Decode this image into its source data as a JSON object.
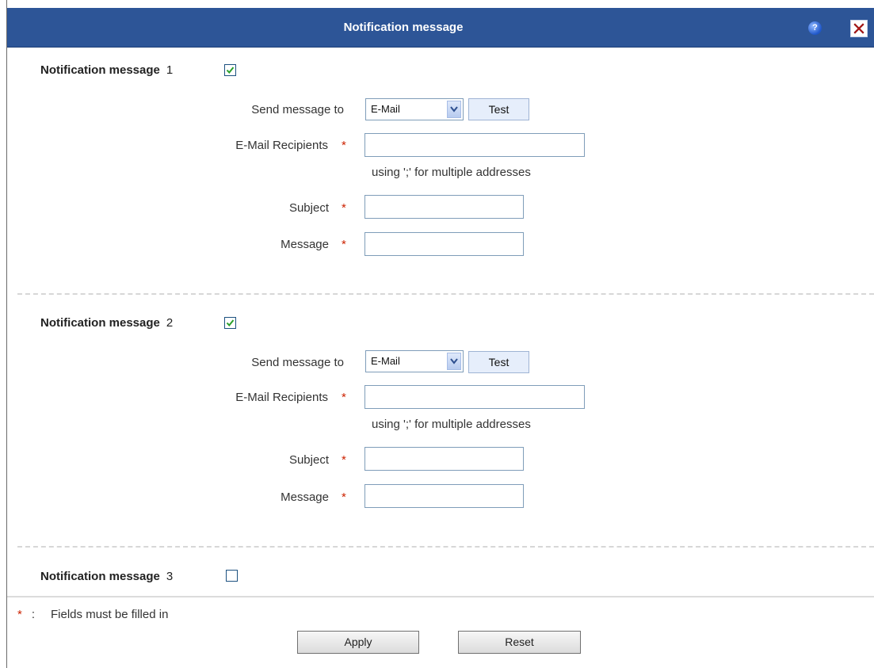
{
  "window": {
    "title": "Notification message",
    "help_icon": "help-icon",
    "close_icon": "close-icon"
  },
  "sections": [
    {
      "heading": "Notification message",
      "number": "1",
      "enabled": true,
      "send_to_label": "Send message to",
      "send_to_value": "E-Mail",
      "test_label": "Test",
      "recipients_label": "E-Mail Recipients",
      "recipients_value": "",
      "hint": "using ';' for multiple addresses",
      "subject_label": "Subject",
      "subject_value": "",
      "message_label": "Message",
      "message_value": ""
    },
    {
      "heading": "Notification message",
      "number": "2",
      "enabled": true,
      "send_to_label": "Send message to",
      "send_to_value": "E-Mail",
      "test_label": "Test",
      "recipients_label": "E-Mail Recipients",
      "recipients_value": "",
      "hint": "using ';' for multiple addresses",
      "subject_label": "Subject",
      "subject_value": "",
      "message_label": "Message",
      "message_value": ""
    },
    {
      "heading": "Notification message",
      "number": "3",
      "enabled": false
    }
  ],
  "required_marker": "*",
  "legend": {
    "marker": "*",
    "colon": ":",
    "text": "Fields must be filled in"
  },
  "buttons": {
    "apply": "Apply",
    "reset": "Reset"
  },
  "colors": {
    "titlebar": "#2d5597",
    "required": "#cc2200"
  }
}
